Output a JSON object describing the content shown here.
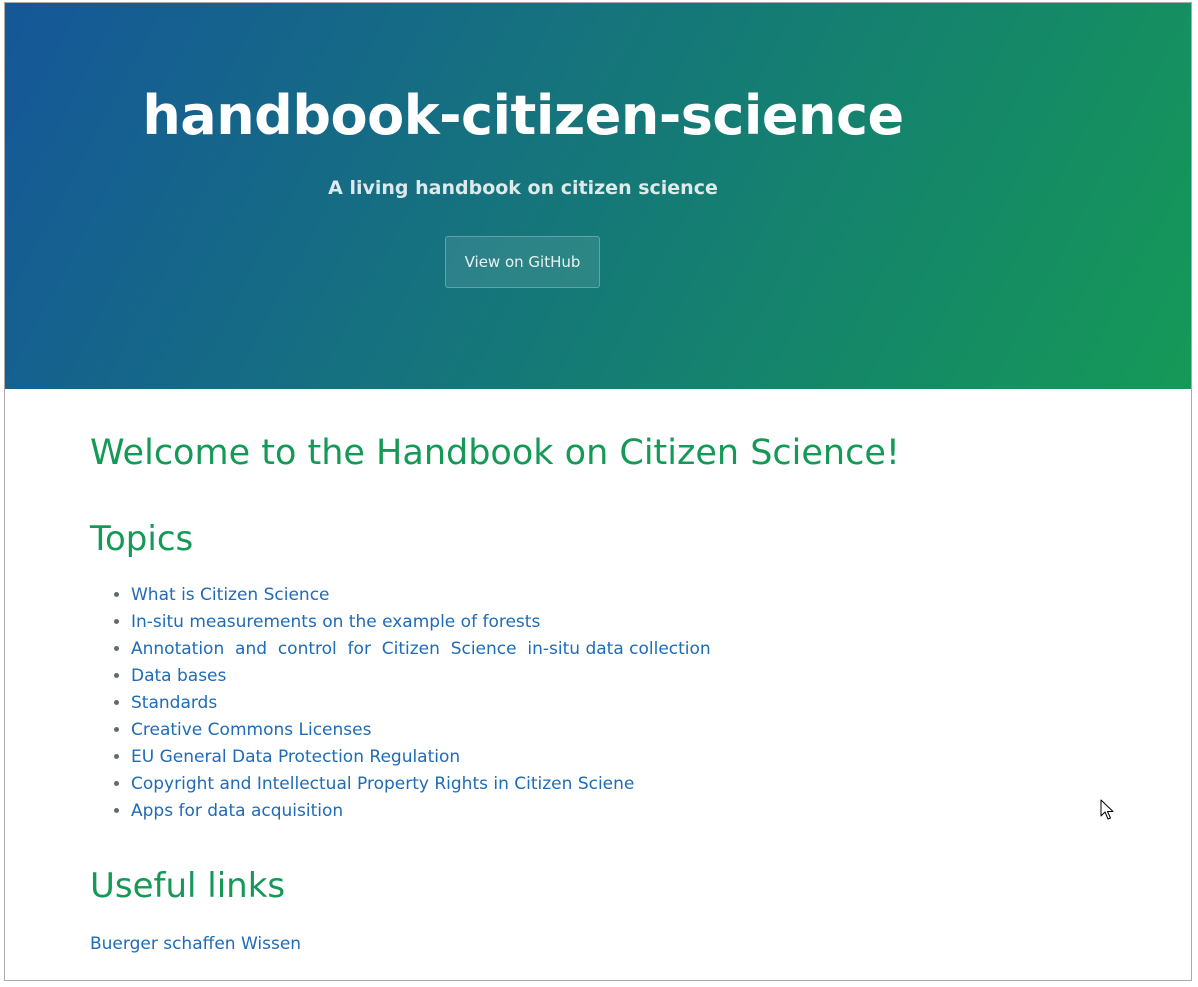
{
  "header": {
    "title": "handbook-citizen-science",
    "tagline": "A living handbook on citizen science",
    "github_button": "View on GitHub"
  },
  "main": {
    "welcome": "Welcome to the Handbook on Citizen Science!",
    "topics_heading": "Topics",
    "topics": [
      "What is Citizen Science",
      "In-situ measurements on the example of forests",
      "Annotation  and  control  for  Citizen  Science  in-situ data collection",
      "Data bases",
      "Standards",
      "Creative Commons Licenses",
      "EU General Data Protection Regulation",
      "Copyright and Intellectual Property Rights in Citizen Sciene",
      "Apps for data acquisition"
    ],
    "useful_heading": "Useful links",
    "useful_links": [
      "Buerger schaffen Wissen"
    ]
  },
  "colors": {
    "gradient_start": "#155799",
    "gradient_end": "#159957",
    "heading": "#159957",
    "link": "#1e6bb8"
  }
}
